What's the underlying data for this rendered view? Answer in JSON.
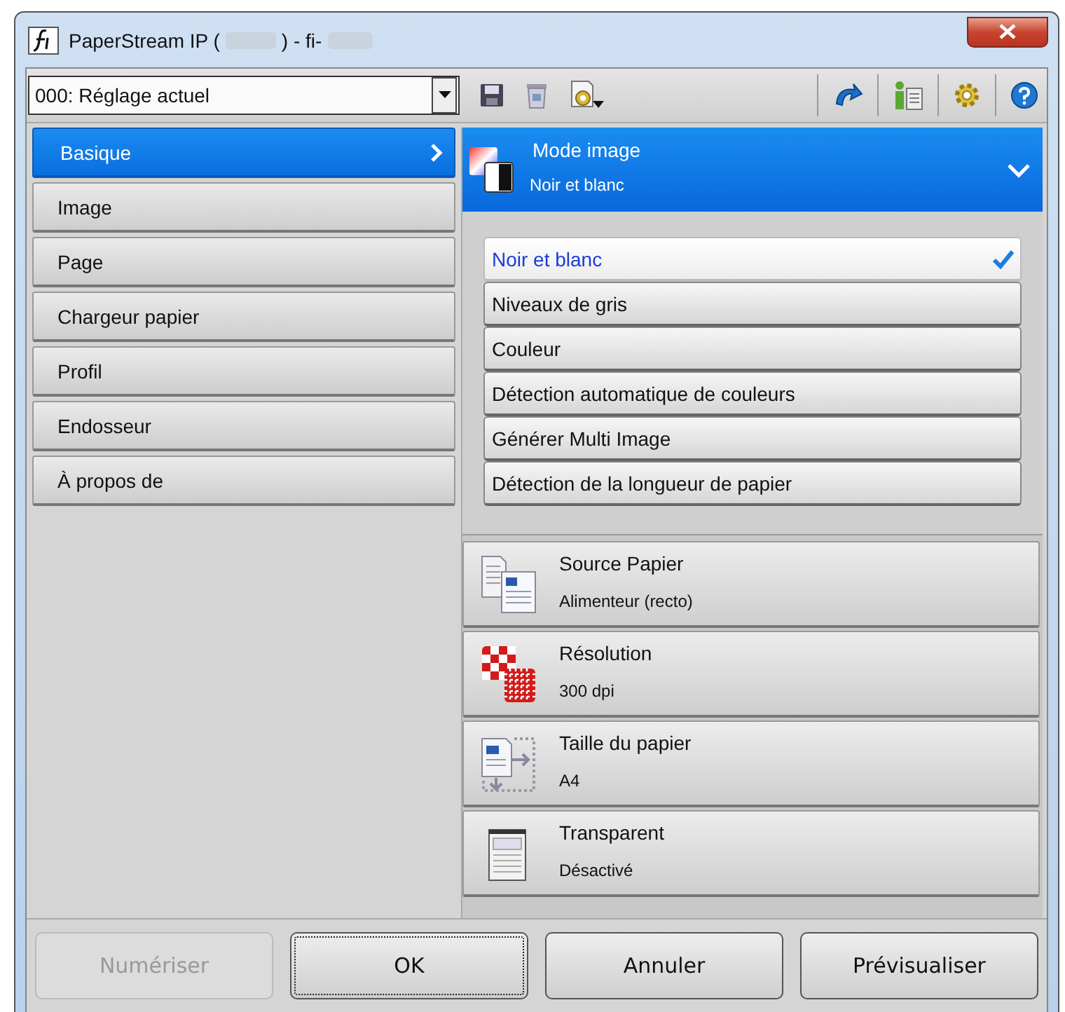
{
  "window": {
    "title_parts": [
      "PaperStream IP (",
      ") - fi-"
    ]
  },
  "profile_select": {
    "value": "000: Réglage actuel"
  },
  "nav": [
    {
      "label": "Basique",
      "selected": true
    },
    {
      "label": "Image",
      "selected": false
    },
    {
      "label": "Page",
      "selected": false
    },
    {
      "label": "Chargeur papier",
      "selected": false
    },
    {
      "label": "Profil",
      "selected": false
    },
    {
      "label": "Endosseur",
      "selected": false
    },
    {
      "label": "À propos de",
      "selected": false
    }
  ],
  "panel": {
    "title": "Mode image",
    "value": "Noir et blanc",
    "expanded": true,
    "options": [
      {
        "label": "Noir et blanc",
        "selected": true
      },
      {
        "label": "Niveaux de gris",
        "selected": false
      },
      {
        "label": "Couleur",
        "selected": false
      },
      {
        "label": "Détection automatique de couleurs",
        "selected": false
      },
      {
        "label": "Générer Multi Image",
        "selected": false
      },
      {
        "label": "Détection de la longueur de papier",
        "selected": false
      }
    ]
  },
  "sections": [
    {
      "kind": "source",
      "title": "Source Papier",
      "value": "Alimenteur (recto)"
    },
    {
      "kind": "resolution",
      "title": "Résolution",
      "value": "300 dpi"
    },
    {
      "kind": "size",
      "title": "Taille du papier",
      "value": "A4"
    },
    {
      "kind": "transparent",
      "title": "Transparent",
      "value": "Désactivé"
    }
  ],
  "buttons": [
    {
      "label": "Numériser",
      "disabled": true,
      "focused": false
    },
    {
      "label": "OK",
      "disabled": false,
      "focused": true
    },
    {
      "label": "Annuler",
      "disabled": false,
      "focused": false
    },
    {
      "label": "Prévisualiser",
      "disabled": false,
      "focused": false
    }
  ]
}
